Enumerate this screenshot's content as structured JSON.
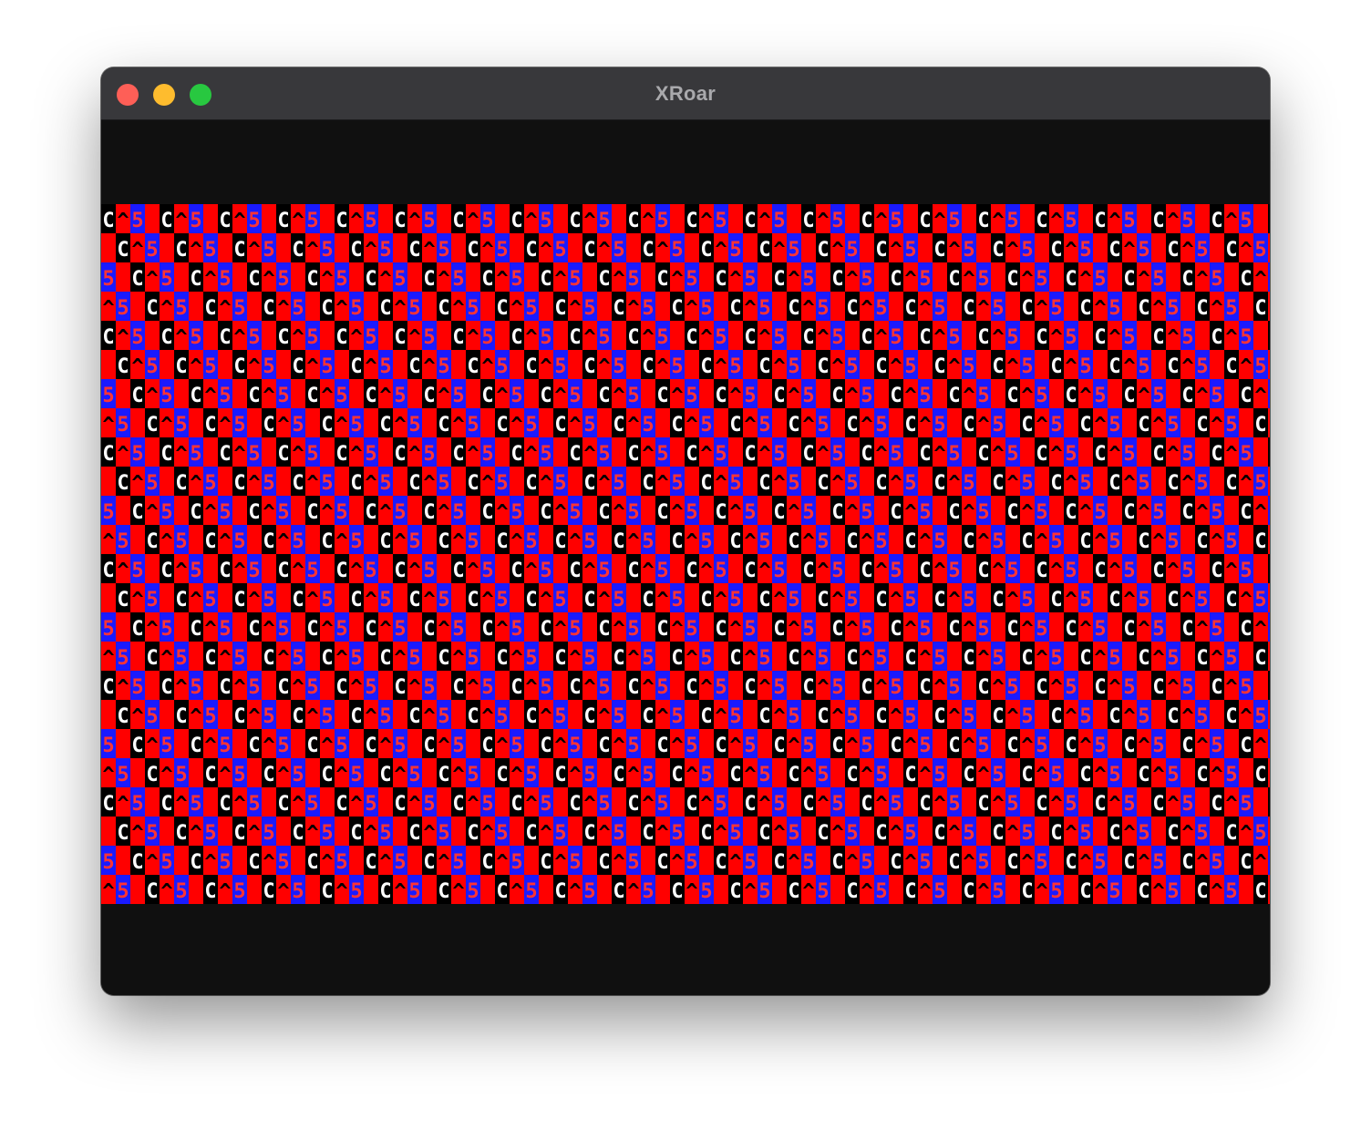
{
  "window": {
    "title": "XRoar",
    "buttons": {
      "close_color": "#fe5f57",
      "minimize_color": "#febc2e",
      "zoom_color": "#28c840"
    }
  },
  "screen": {
    "border_color": "#101010",
    "cycle": [
      {
        "char": "C",
        "bg": "#000000",
        "fg": "#ffffff"
      },
      {
        "char": "^",
        "bg": "#ff0000",
        "fg": "#000000"
      },
      {
        "char": "5",
        "bg": "#1a1aff",
        "fg": "#ff3333"
      },
      {
        "char": "",
        "bg": "#ff0000",
        "fg": "#ff0000"
      }
    ]
  }
}
